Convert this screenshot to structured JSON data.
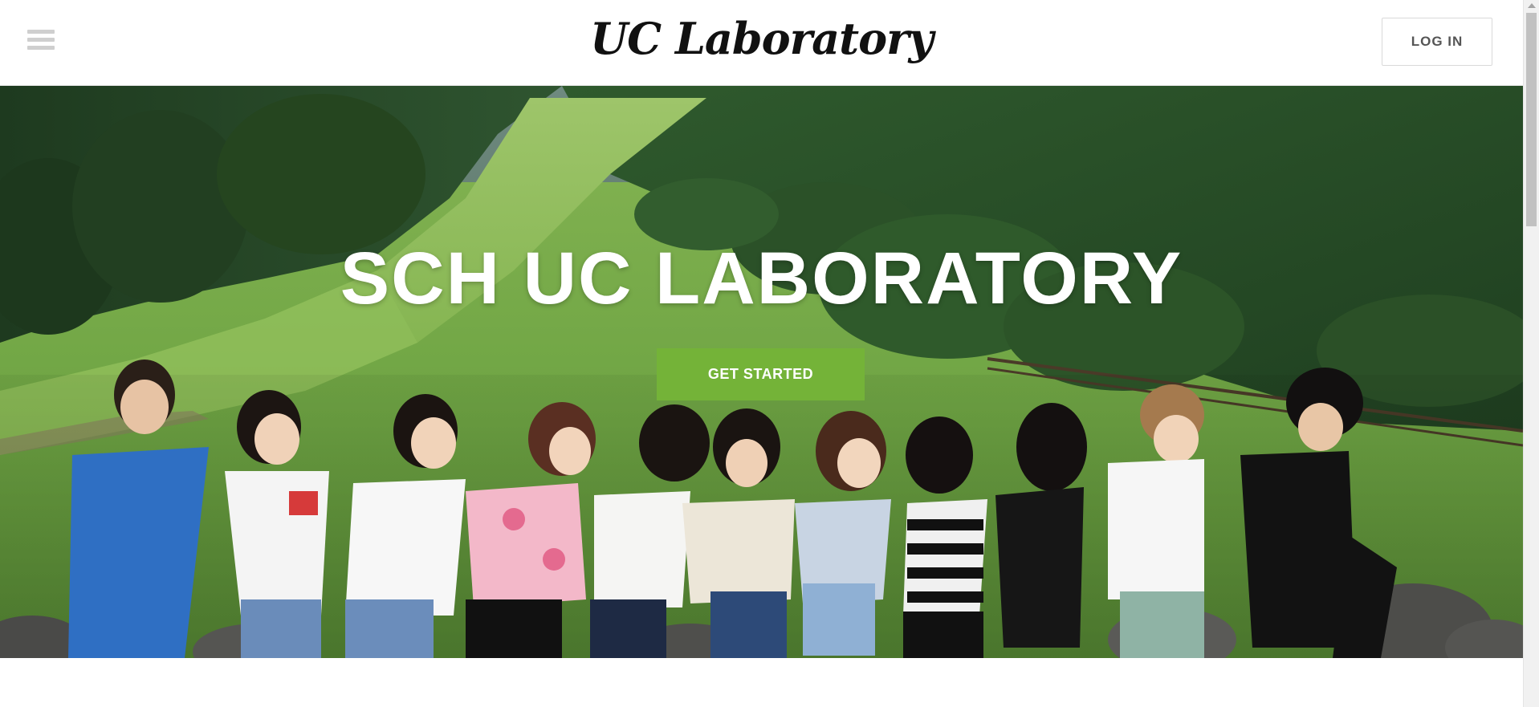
{
  "header": {
    "brand": "UC Laboratory",
    "login_label": "LOG IN"
  },
  "hero": {
    "title": "SCH UC LABORATORY",
    "cta_label": "GET STARTED",
    "background": "group photo of lab members walking in a line on a grassy green hillside with dark forest and stone wall",
    "cta_color": "#74b338"
  },
  "icons": {
    "menu": "hamburger-menu-icon"
  }
}
